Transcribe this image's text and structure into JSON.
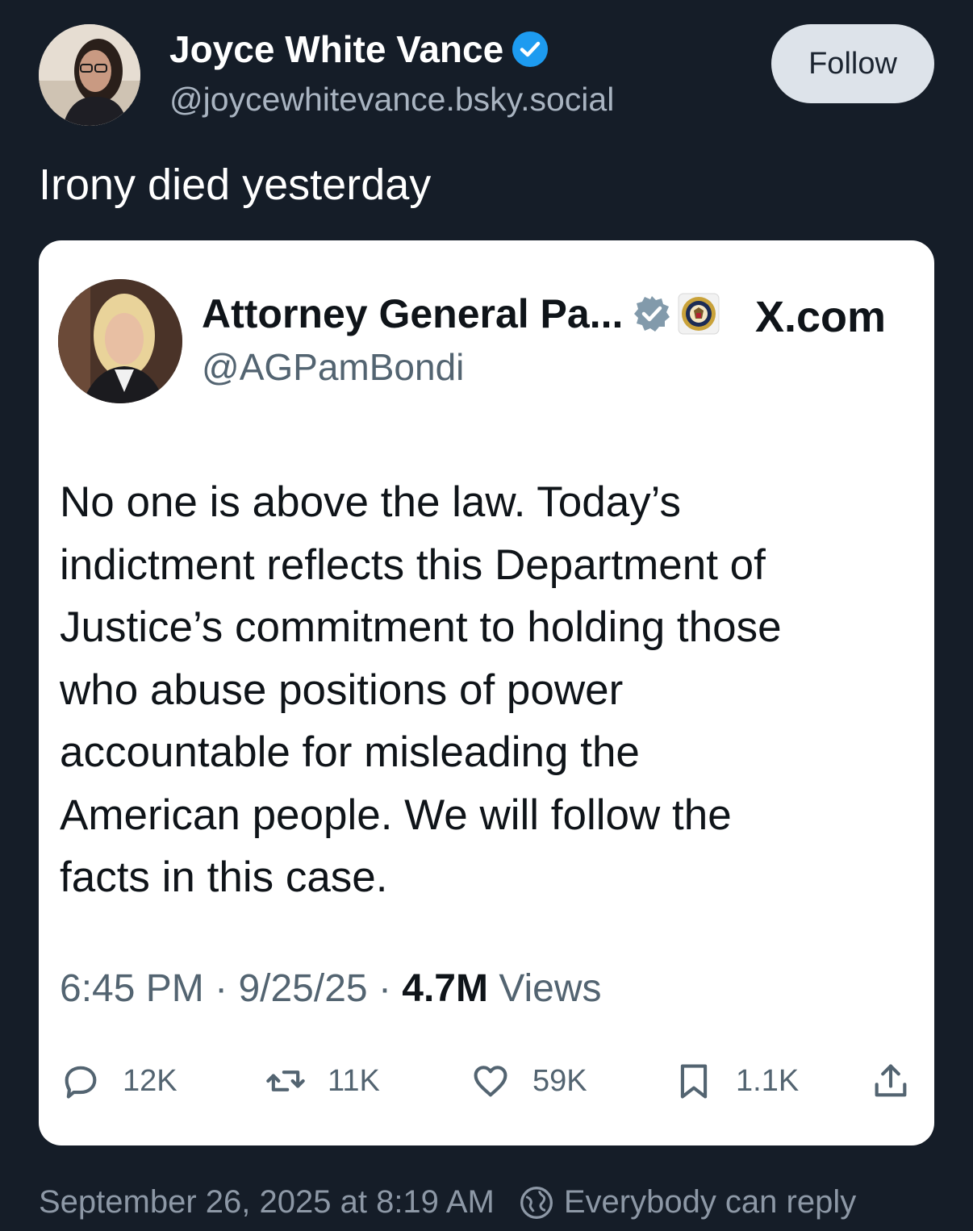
{
  "post": {
    "author": {
      "display_name": "Joyce White Vance",
      "handle": "@joycewhitevance.bsky.social",
      "verified": true
    },
    "follow_label": "Follow",
    "text": "Irony died yesterday",
    "timestamp": "September 26, 2025 at 8:19 AM",
    "reply_setting": "Everybody can reply"
  },
  "quoted": {
    "author": {
      "display_name": "Attorney General Pa...",
      "handle": "@AGPamBondi"
    },
    "source": "X.com",
    "body_lines": [
      "No one is above the law. Today’s",
      "indictment reflects this Department of",
      "Justice’s commitment to holding those",
      "who abuse positions of power",
      "accountable for misleading the",
      "American people. We will follow the",
      "facts in this case."
    ],
    "time": "6:45 PM",
    "date": "9/25/25",
    "views_count": "4.7M",
    "views_label": "Views",
    "stats": {
      "replies": "12K",
      "reposts": "11K",
      "likes": "59K",
      "bookmarks": "1.1K"
    }
  },
  "colors": {
    "background": "#151d28",
    "verified_blue": "#1d9bf0",
    "card_background": "#ffffff",
    "muted_text": "#536471"
  }
}
